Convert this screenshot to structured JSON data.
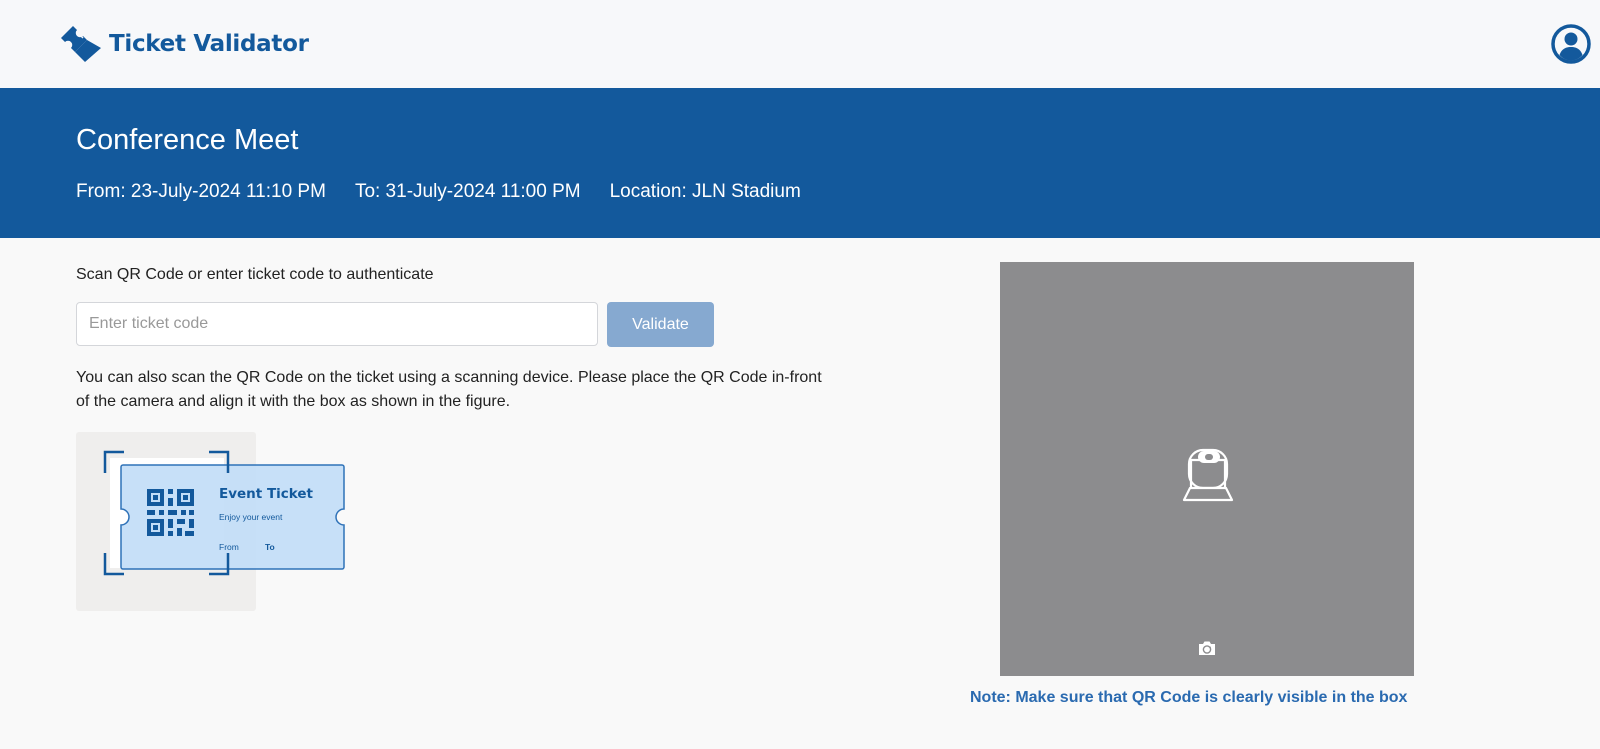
{
  "app": {
    "name": "Ticket Validator",
    "brand_color": "#13599c"
  },
  "header": {
    "logo_icon": "ticket-icon",
    "avatar_icon": "user-circle-icon"
  },
  "event": {
    "title": "Conference Meet",
    "from": "From: 23-July-2024 11:10 PM",
    "to": "To: 31-July-2024 11:00 PM",
    "location": "Location: JLN Stadium"
  },
  "validation": {
    "instruction": "Scan QR Code or enter ticket code to authenticate",
    "input_placeholder": "Enter ticket code",
    "input_value": "",
    "button_label": "Validate",
    "help_text": "You can also scan the QR Code on the ticket using a scanning device. Please place the QR Code in-front of the camera and align it with the box as shown in the figure."
  },
  "illustration": {
    "ticket_title": "Event Ticket",
    "ticket_subtitle": "Enjoy your event",
    "ticket_from": "From",
    "ticket_to": "To"
  },
  "scanner": {
    "camera_icon": "webcam-icon",
    "switch_icon": "switch-camera-icon",
    "note": "Note: Make sure that QR Code is clearly visible in the box"
  }
}
